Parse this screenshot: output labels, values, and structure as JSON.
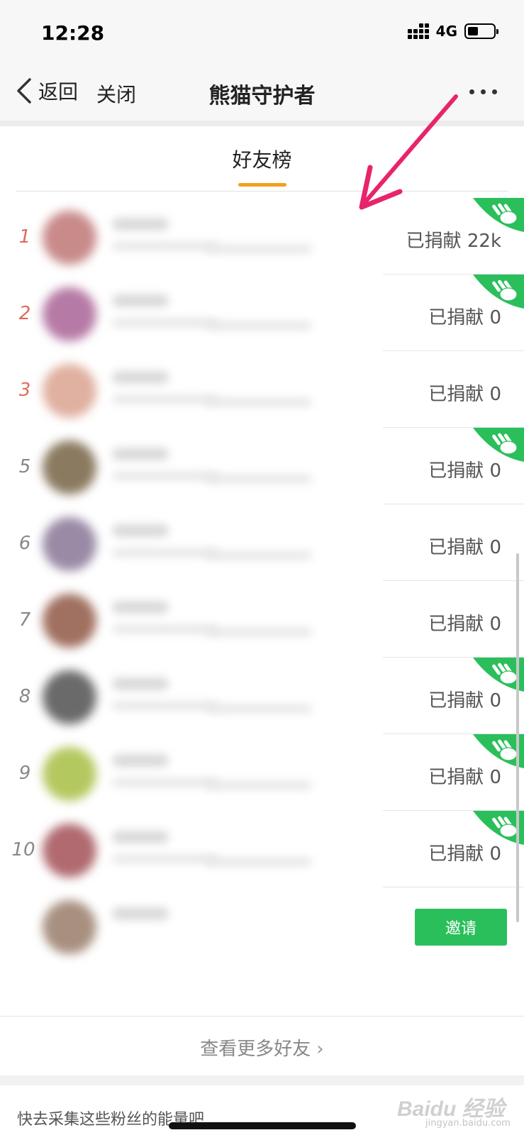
{
  "status_bar": {
    "time": "12:28",
    "network": "4G",
    "signal_icon": "signal-dots-icon",
    "battery_icon": "battery-icon"
  },
  "nav": {
    "back_label": "返回",
    "close_label": "关闭",
    "title": "熊猫守护者",
    "more_icon": "more-dots-icon"
  },
  "tabs": [
    {
      "label": "好友榜",
      "active": true
    }
  ],
  "colors": {
    "accent": "#f0a020",
    "green": "#2bbf5b",
    "rank_top": "#e06a5a",
    "annotation": "#e8246a"
  },
  "ranking": [
    {
      "rank": "1",
      "donated": "已捐献 22k",
      "hand": true,
      "avatar_color": "#c98a8a"
    },
    {
      "rank": "2",
      "donated": "已捐献 0",
      "hand": true,
      "avatar_color": "#b67aa6"
    },
    {
      "rank": "3",
      "donated": "已捐献 0",
      "hand": false,
      "avatar_color": "#e0b0a0"
    },
    {
      "rank": "5",
      "donated": "已捐献 0",
      "hand": true,
      "avatar_color": "#8a7a60"
    },
    {
      "rank": "6",
      "donated": "已捐献 0",
      "hand": false,
      "avatar_color": "#9a8aa6"
    },
    {
      "rank": "7",
      "donated": "已捐献 0",
      "hand": false,
      "avatar_color": "#a07060"
    },
    {
      "rank": "8",
      "donated": "已捐献 0",
      "hand": true,
      "avatar_color": "#6a6a6a"
    },
    {
      "rank": "9",
      "donated": "已捐献 0",
      "hand": true,
      "avatar_color": "#b4c860"
    },
    {
      "rank": "10",
      "donated": "已捐献 0",
      "hand": true,
      "avatar_color": "#b06a70"
    }
  ],
  "invite_row": {
    "invite_label": "邀请",
    "avatar_color": "#a89080"
  },
  "view_more_label": "查看更多好友",
  "footer_hint": "快去采集这些粉丝的能量吧",
  "watermark": {
    "brand": "Baidu 经验",
    "url": "jingyan.baidu.com"
  }
}
